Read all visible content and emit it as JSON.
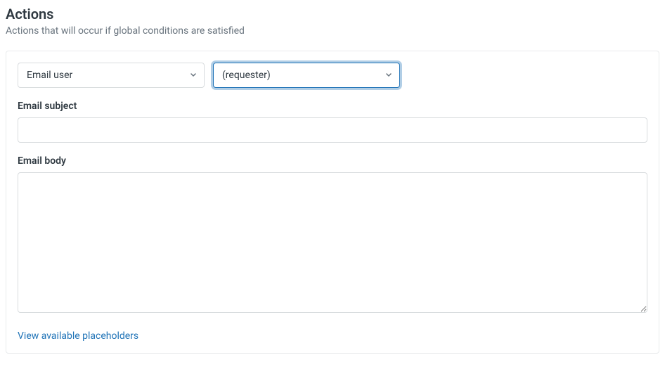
{
  "header": {
    "title": "Actions",
    "subtitle": "Actions that will occur if global conditions are satisfied"
  },
  "action": {
    "type_select": {
      "selected": "Email user"
    },
    "recipient_select": {
      "selected": "(requester)"
    },
    "subject": {
      "label": "Email subject",
      "value": ""
    },
    "body": {
      "label": "Email body",
      "value": ""
    },
    "placeholders_link": "View available placeholders"
  }
}
